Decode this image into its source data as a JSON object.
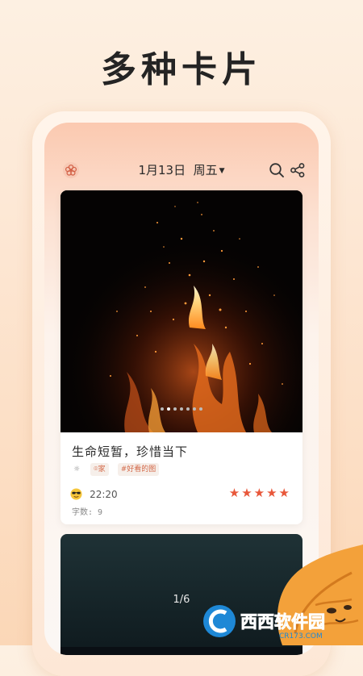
{
  "hero": {
    "title": "多种卡片"
  },
  "topbar": {
    "date": "1月13日",
    "weekday": "周五",
    "icons": [
      "flower-icon",
      "search-icon",
      "share-icon",
      "chevron-down-icon"
    ]
  },
  "card1": {
    "title": "生命短暂，珍惜当下",
    "location": "家",
    "tag": "#好看的图",
    "time": "22:20",
    "rating": 5,
    "stars": "★★★★★",
    "word_count": "字数: 9",
    "photo_count_dots": 7,
    "active_dot": 1
  },
  "card2": {
    "pager": "1/6"
  },
  "watermark": {
    "text": "西西软件园",
    "domain": "CR173.COM"
  },
  "colors": {
    "accent": "#e8573a",
    "tag_text": "#d46a4a",
    "background": "#fde6d2"
  }
}
